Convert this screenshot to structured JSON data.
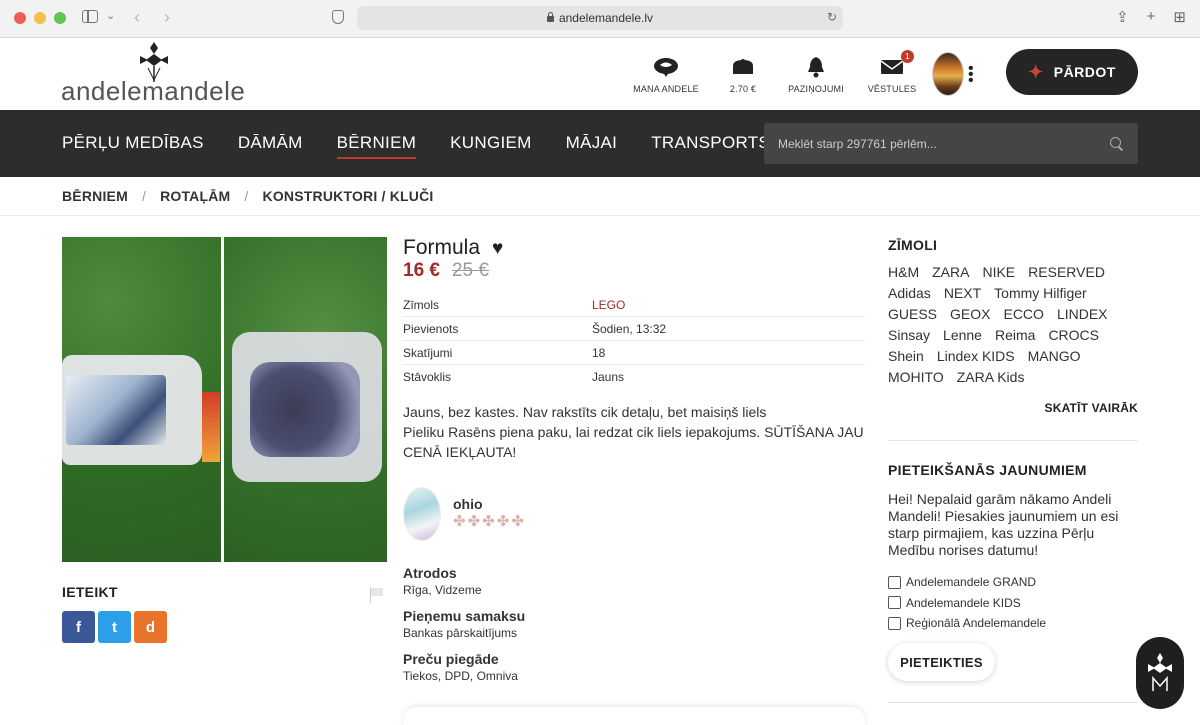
{
  "browser": {
    "url": "andelemandele.lv"
  },
  "header": {
    "logo_text": "andelemandele",
    "items": [
      {
        "label": "MANA ANDELE",
        "icon": "speech-bubble-icon"
      },
      {
        "label": "2.70 €",
        "icon": "wallet-icon"
      },
      {
        "label": "PAZIŅOJUMI",
        "icon": "bell-icon"
      },
      {
        "label": "VĒSTULES",
        "icon": "envelope-icon",
        "badge": "1"
      }
    ],
    "sell_label": "PĀRDOT"
  },
  "nav": {
    "items": [
      "PĒRĻU MEDĪBAS",
      "DĀMĀM",
      "BĒRNIEM",
      "KUNGIEM",
      "MĀJAI",
      "TRANSPORTS"
    ],
    "active": "BĒRNIEM",
    "search_placeholder": "Meklēt starp 297761 pērlēm..."
  },
  "breadcrumb": [
    "BĒRNIEM",
    "ROTAĻĀM",
    "KONSTRUKTORI / KLUČI"
  ],
  "product": {
    "title": "Formula",
    "price": "16 €",
    "old_price": "25 €",
    "details": [
      {
        "key": "Zīmols",
        "value": "LEGO"
      },
      {
        "key": "Pievienots",
        "value": "Šodien, 13:32"
      },
      {
        "key": "Skatījumi",
        "value": "18"
      },
      {
        "key": "Stāvoklis",
        "value": "Jauns"
      }
    ],
    "description_1": "Jauns, bez kastes. Nav rakstīts cik detaļu, bet maisiņš liels",
    "description_2": "Pieliku Rasēns piena paku, lai redzat cik liels iepakojums. SŪTĪŠANA JAU CENĀ IEKĻAUTA!",
    "seller": {
      "name": "ohio",
      "rating_stars": 5
    },
    "location": {
      "title": "Atrodos",
      "value": "Rīga, Vidzeme"
    },
    "payment": {
      "title": "Pieņemu samaksu",
      "value": "Bankas pārskaitījums"
    },
    "delivery": {
      "title": "Preču piegāde",
      "value": "Tiekos, DPD, Omniva"
    }
  },
  "share": {
    "title": "IETEIKT",
    "buttons": [
      {
        "label": "f",
        "name": "facebook-share-button"
      },
      {
        "label": "t",
        "name": "twitter-share-button"
      },
      {
        "label": "d",
        "name": "draugiem-share-button"
      }
    ]
  },
  "sidebar": {
    "brands_title": "ZĪMOLI",
    "brands": [
      "H&M",
      "ZARA",
      "NIKE",
      "RESERVED",
      "Adidas",
      "NEXT",
      "Tommy Hilfiger",
      "GUESS",
      "GEOX",
      "ECCO",
      "LINDEX",
      "Sinsay",
      "Lenne",
      "Reima",
      "CROCS",
      "Shein",
      "Lindex KIDS",
      "MANGO",
      "MOHITO",
      "ZARA Kids"
    ],
    "more_label": "SKATĪT VAIRĀK",
    "newsletter_title": "PIETEIKŠANĀS JAUNUMIEM",
    "newsletter_text": "Hei! Nepalaid garām nākamo Andeli Mandeli! Piesakies jaunumiem un esi starp pirmajiem, kas uzzina Pērļu Medību norises datumu!",
    "options": [
      "Andelemandele GRAND",
      "Andelemandele KIDS",
      "Reģionālā Andelemandele"
    ],
    "subscribe_label": "PIETEIKTIES"
  },
  "colors": {
    "accent": "#a52a2a",
    "nav_bg": "#2d2d2d"
  }
}
